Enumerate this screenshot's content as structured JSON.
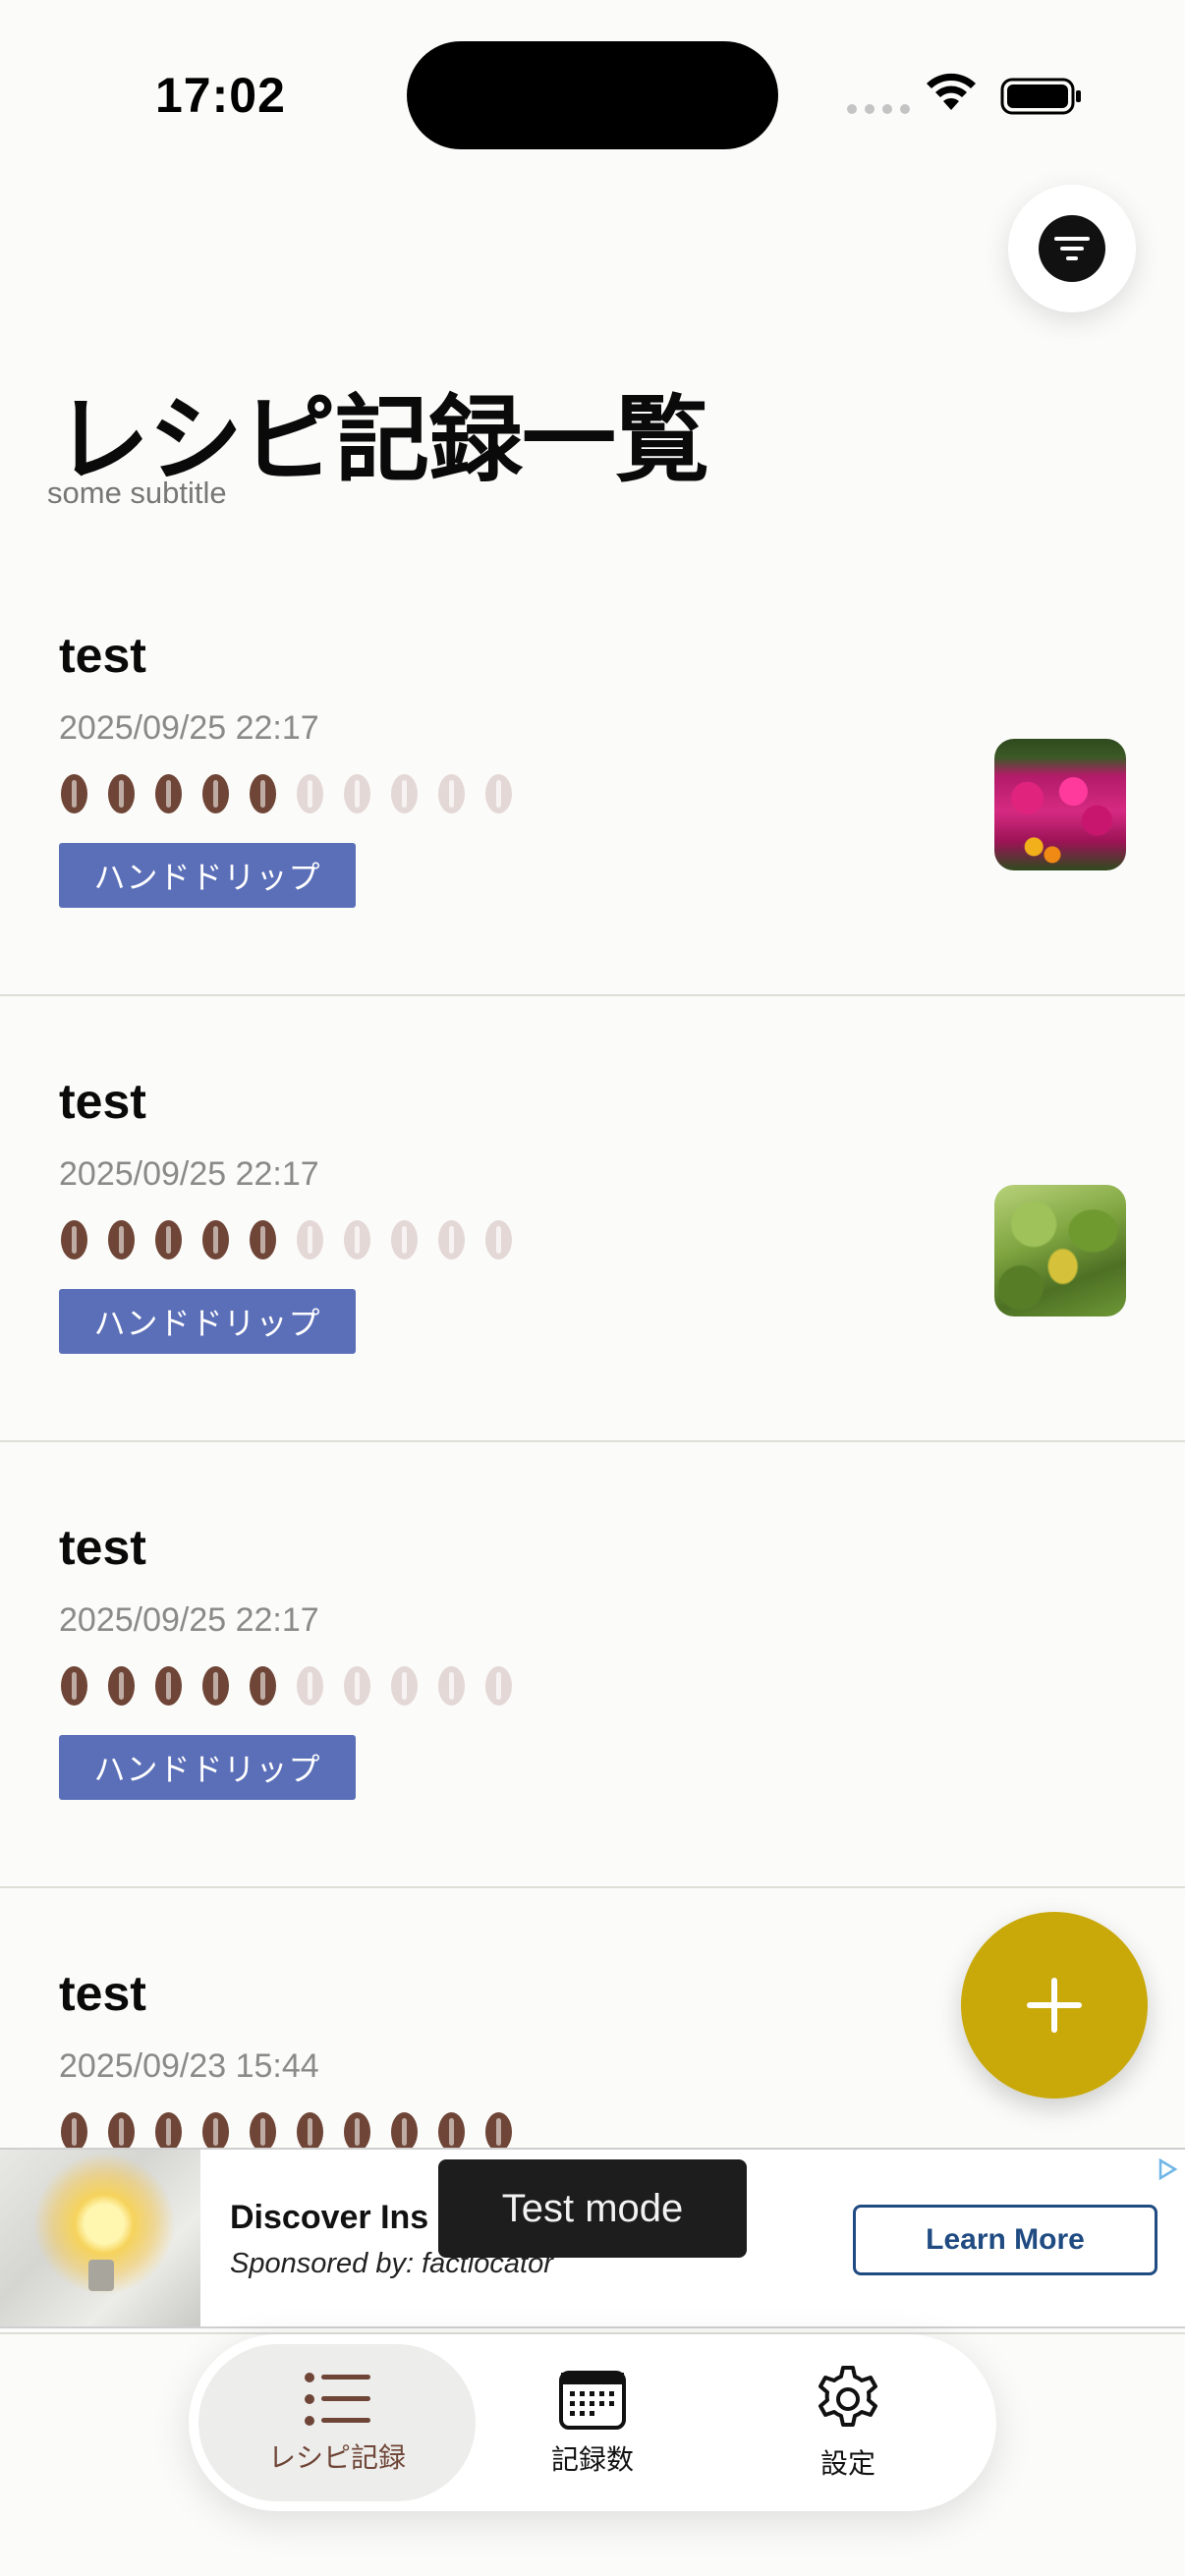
{
  "status_bar": {
    "time": "17:02"
  },
  "header": {
    "title": "レシピ記録一覧",
    "subtitle": "some subtitle",
    "filter_icon": "filter-icon"
  },
  "recipes": [
    {
      "name": "test",
      "date": "2025/09/25 22:17",
      "rating": 5,
      "rating_max": 10,
      "method": "ハンドドリップ",
      "thumbnail": "flowers"
    },
    {
      "name": "test",
      "date": "2025/09/25 22:17",
      "rating": 5,
      "rating_max": 10,
      "method": "ハンドドリップ",
      "thumbnail": "leaves"
    },
    {
      "name": "test",
      "date": "2025/09/25 22:17",
      "rating": 5,
      "rating_max": 10,
      "method": "ハンドドリップ",
      "thumbnail": ""
    },
    {
      "name": "test",
      "date": "2025/09/23 15:44",
      "rating": 10,
      "rating_max": 10,
      "method": "",
      "thumbnail": ""
    }
  ],
  "fab": {
    "icon": "plus-icon"
  },
  "ad": {
    "title": "Discover Ins",
    "sponsor": "Sponsored by: factlocator",
    "cta": "Learn More",
    "test_mode": "Test mode"
  },
  "tabs": [
    {
      "label": "レシピ記録",
      "icon": "list-icon",
      "active": true
    },
    {
      "label": "記録数",
      "icon": "calendar-icon",
      "active": false
    },
    {
      "label": "設定",
      "icon": "gear-icon",
      "active": false
    }
  ],
  "colors": {
    "bean_filled": "#6e4536",
    "bean_empty": "#e4d8d6",
    "badge": "#5b6fb8",
    "fab": "#c9a90a",
    "ad_cta": "#1f4b82"
  }
}
